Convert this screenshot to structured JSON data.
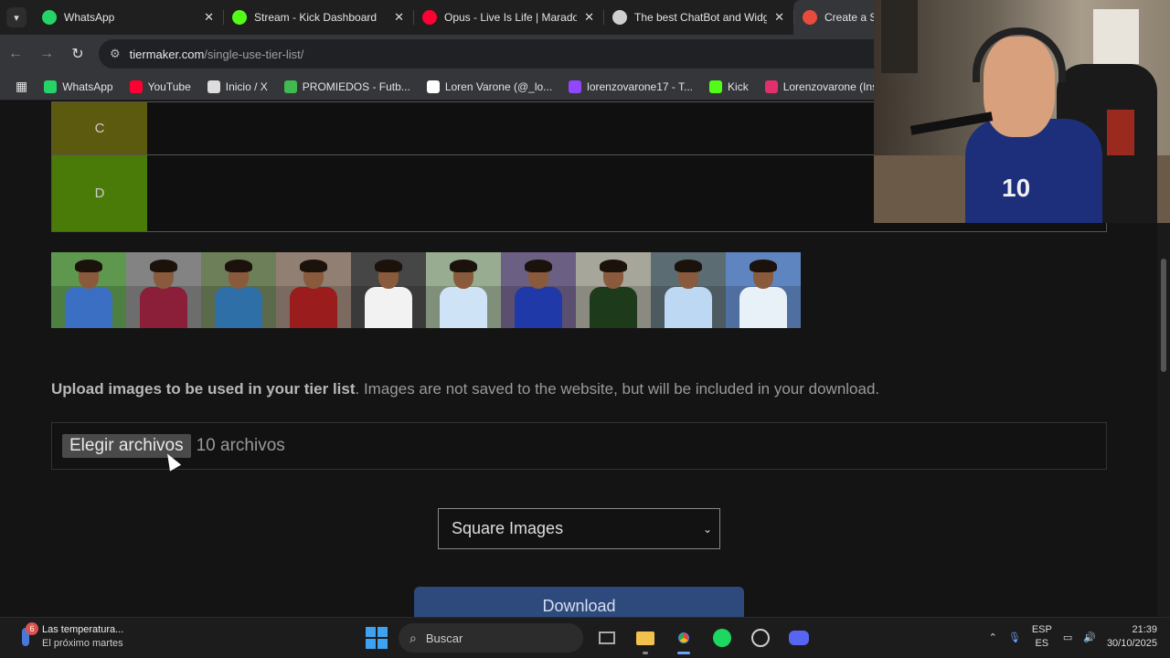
{
  "browser": {
    "tabs": [
      {
        "title": "WhatsApp",
        "icon": "whatsapp-icon",
        "color": "#25d366"
      },
      {
        "title": "Stream - Kick Dashboard",
        "icon": "kick-icon",
        "color": "#53fc18"
      },
      {
        "title": "Opus - Live Is Life | Marador",
        "icon": "youtube-icon",
        "color": "#ff0033"
      },
      {
        "title": "The best ChatBot and Widge",
        "icon": "botrix-icon",
        "color": "#cfcfcf"
      },
      {
        "title": "Create a Sin",
        "icon": "tiermaker-icon",
        "color": "#e74c3c"
      }
    ],
    "address": {
      "host": "tiermaker.com",
      "path": "/single-use-tier-list/"
    },
    "bookmarks": [
      {
        "label": "WhatsApp",
        "color": "#25d366"
      },
      {
        "label": "YouTube",
        "color": "#ff0033"
      },
      {
        "label": "Inicio / X",
        "color": "#dddddd"
      },
      {
        "label": "PROMIEDOS - Futb...",
        "color": "#3fb950"
      },
      {
        "label": "Loren Varone (@_lo...",
        "color": "#ffffff"
      },
      {
        "label": "lorenzovarone17 - T...",
        "color": "#9146ff"
      },
      {
        "label": "Kick",
        "color": "#53fc18"
      },
      {
        "label": "Lorenzovarone (Inst...",
        "color": "#e1306c"
      }
    ]
  },
  "tiers": [
    {
      "label": "C",
      "color": "#5b5a0e",
      "height": 58
    },
    {
      "label": "D",
      "color": "#4a7a08",
      "height": 84
    }
  ],
  "pool_images": [
    {
      "sky": "#4e7f42",
      "shirt": "#3a6fc4"
    },
    {
      "sky": "#6d6d6d",
      "shirt": "#8b1f3a"
    },
    {
      "sky": "#5a6a4a",
      "shirt": "#2f6fa8"
    },
    {
      "sky": "#7a6a60",
      "shirt": "#9b1c1c"
    },
    {
      "sky": "#3a3a3a",
      "shirt": "#f2f2f2"
    },
    {
      "sky": "#7f8f7a",
      "shirt": "#cfe3f7"
    },
    {
      "sky": "#5a4f6e",
      "shirt": "#1f3aa8"
    },
    {
      "sky": "#8a8a80",
      "shirt": "#1d3a1a"
    },
    {
      "sky": "#4d5a60",
      "shirt": "#bcd8f2"
    },
    {
      "sky": "#4f6fa0",
      "shirt": "#e8f0f8"
    }
  ],
  "upload": {
    "bold": "Upload images to be used in your tier list",
    "rest": ". Images are not saved to the website, but will be included in your download.",
    "button": "Elegir archivos",
    "status": "10 archivos"
  },
  "image_shape": {
    "selected": "Square Images"
  },
  "download_label": "Download",
  "webcam": {
    "jersey_number": "10"
  },
  "taskbar": {
    "weather_line1": "Las temperatura...",
    "weather_line2": "El próximo martes",
    "weather_badge": "6",
    "search_placeholder": "Buscar",
    "lang1": "ESP",
    "lang2": "ES",
    "time": "21:39",
    "date": "30/10/2025"
  }
}
